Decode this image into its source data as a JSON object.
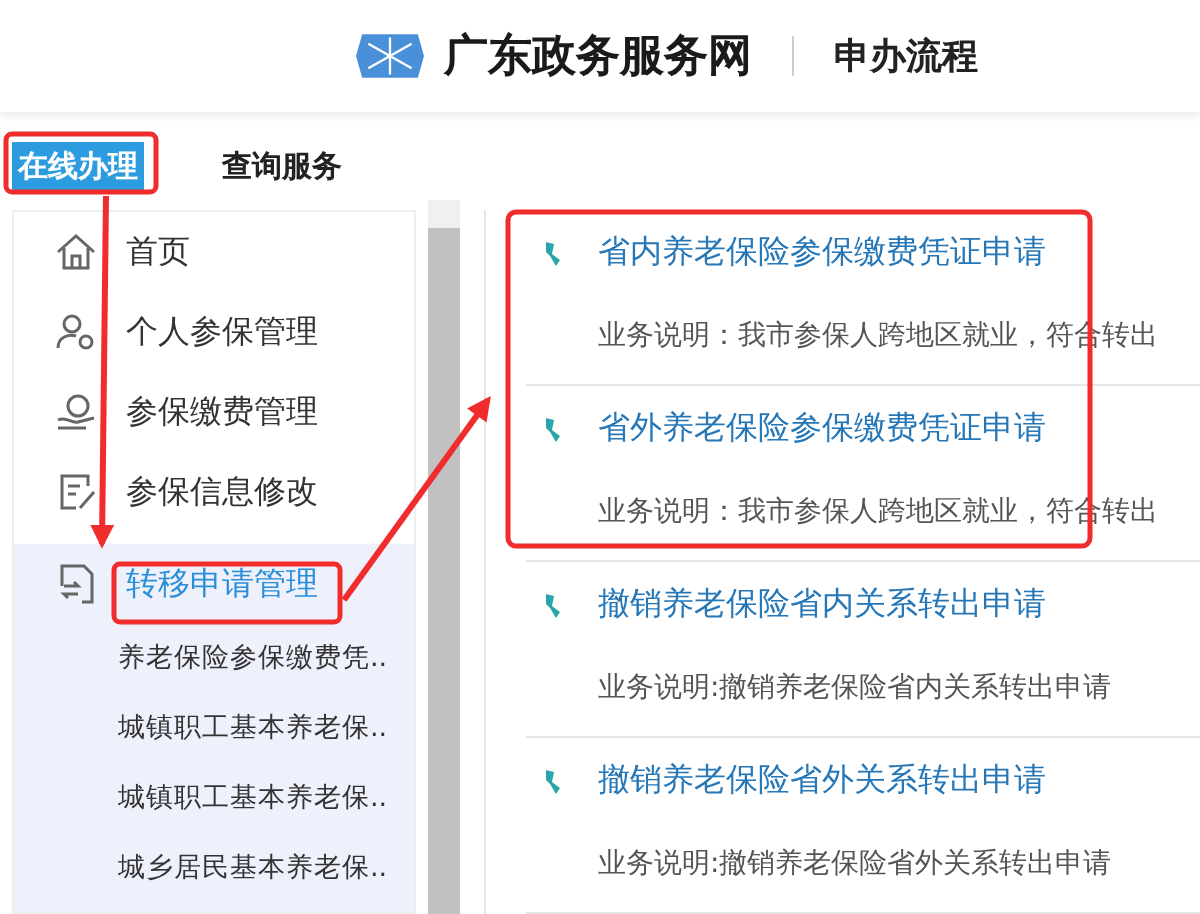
{
  "header": {
    "logo_text": "广东政务服务网",
    "page_title": "申办流程"
  },
  "nav_tabs": [
    {
      "label": "在线办理",
      "selected": true
    },
    {
      "label": "查询服务",
      "selected": false
    }
  ],
  "sidebar": {
    "items": [
      {
        "label": "首页",
        "kind": "home",
        "selected": false
      },
      {
        "label": "个人参保管理",
        "kind": "person",
        "selected": false
      },
      {
        "label": "参保缴费管理",
        "kind": "payment",
        "selected": false
      },
      {
        "label": "参保信息修改",
        "kind": "edit",
        "selected": false
      },
      {
        "label": "转移申请管理",
        "kind": "transfer",
        "selected": true,
        "children": [
          {
            "label": "养老保险参保缴费凭.."
          },
          {
            "label": "城镇职工基本养老保.."
          },
          {
            "label": "城镇职工基本养老保.."
          },
          {
            "label": "城乡居民基本养老保.."
          }
        ]
      }
    ]
  },
  "services": [
    {
      "title": "省内养老保险参保缴费凭证申请",
      "description": "业务说明：我市参保人跨地区就业，符合转出"
    },
    {
      "title": "省外养老保险参保缴费凭证申请",
      "description": "业务说明：我市参保人跨地区就业，符合转出"
    },
    {
      "title": "撤销养老保险省内关系转出申请",
      "description": "业务说明:撤销养老保险省内关系转出申请"
    },
    {
      "title": "撤销养老保险省外关系转出申请",
      "description": "业务说明:撤销养老保险省外关系转出申请"
    }
  ]
}
